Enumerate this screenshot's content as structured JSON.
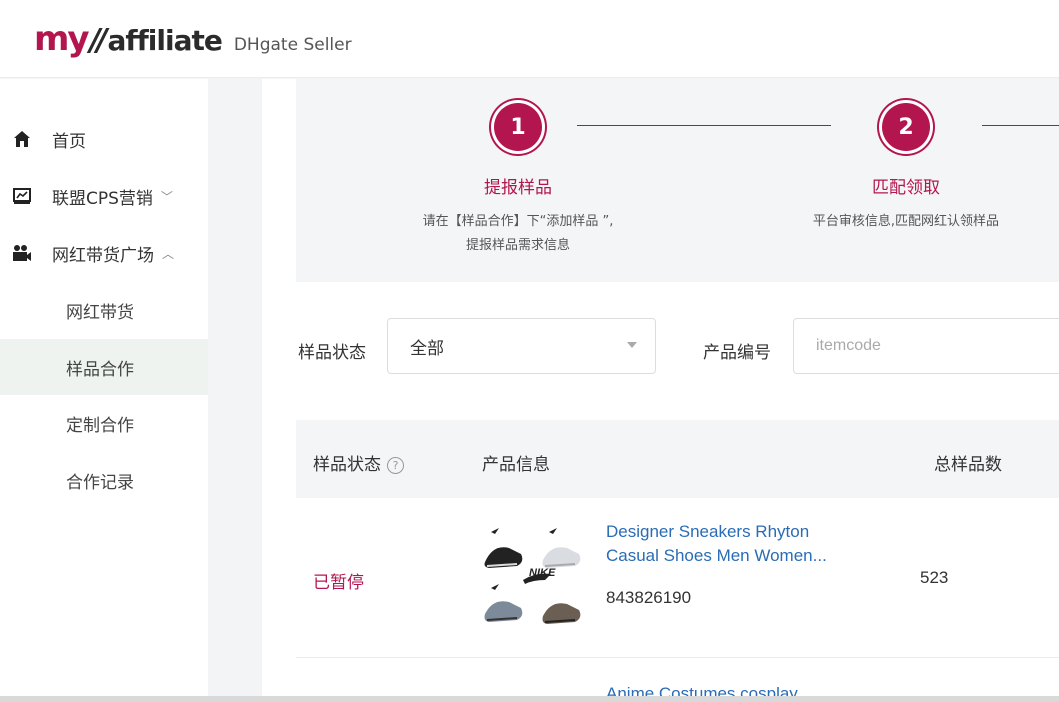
{
  "header": {
    "logo_my": "my",
    "logo_slash": "//",
    "logo_affiliate": "affiliate",
    "subtitle": "DHgate Seller"
  },
  "sidebar": {
    "items": [
      {
        "label": "首页",
        "icon": "home-icon"
      },
      {
        "label": "联盟CPS营销",
        "icon": "chart-icon",
        "arrow": "﹀"
      },
      {
        "label": "网红带货广场",
        "icon": "video-icon",
        "arrow": "︿"
      }
    ],
    "subitems": [
      {
        "label": "网红带货"
      },
      {
        "label": "样品合作",
        "active": true
      },
      {
        "label": "定制合作"
      },
      {
        "label": "合作记录"
      }
    ]
  },
  "steps": [
    {
      "number": "1",
      "title": "提报样品",
      "desc1": "请在【样品合作】下“添加样品 ”,",
      "desc2": "提报样品需求信息"
    },
    {
      "number": "2",
      "title": "匹配领取",
      "desc1": "平台审核信息,匹配网红认领样品",
      "desc2": ""
    }
  ],
  "filters": {
    "status_label": "样品状态",
    "status_value": "全部",
    "code_label": "产品编号",
    "code_placeholder": "itemcode"
  },
  "table": {
    "headers": {
      "status": "样品状态",
      "product": "产品信息",
      "total": "总样品数"
    },
    "rows": [
      {
        "status": "已暂停",
        "title1": "Designer Sneakers Rhyton",
        "title2": "Casual Shoes Men Women...",
        "code": "843826190",
        "total": "523"
      },
      {
        "status": "",
        "title1": "Anime Costumes cosplay",
        "title2": "",
        "code": "",
        "total": ""
      }
    ]
  },
  "colors": {
    "accent": "#b3164e",
    "link": "#2a6cb5"
  }
}
